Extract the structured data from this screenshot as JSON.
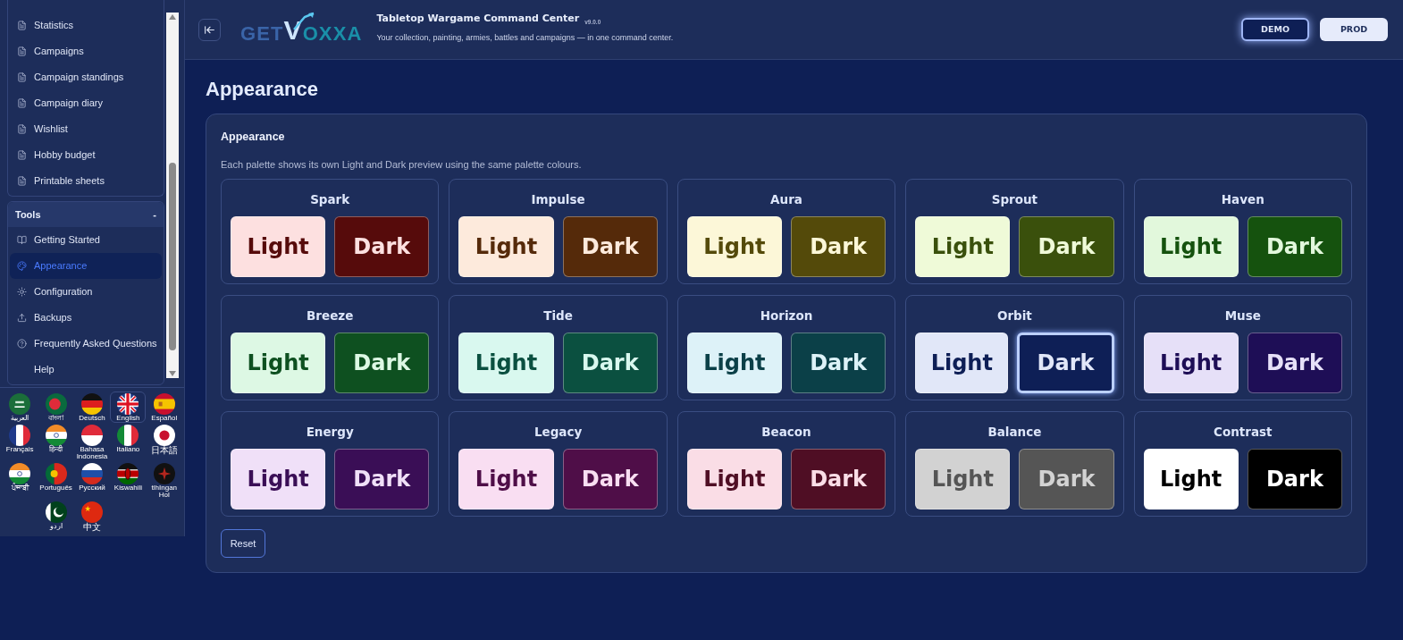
{
  "sidebar": {
    "groups": [
      {
        "items": [
          {
            "label": "Statistics",
            "selected": false
          },
          {
            "label": "Campaigns",
            "selected": false
          },
          {
            "label": "Campaign standings",
            "selected": false
          },
          {
            "label": "Campaign diary",
            "selected": false
          },
          {
            "label": "Wishlist",
            "selected": false
          },
          {
            "label": "Hobby budget",
            "selected": false
          },
          {
            "label": "Printable sheets",
            "selected": false
          }
        ]
      },
      {
        "title": "Tools",
        "toggle": "-",
        "expanded": true,
        "items": [
          {
            "label": "Getting Started",
            "selected": false
          },
          {
            "label": "Appearance",
            "selected": true
          },
          {
            "label": "Configuration",
            "selected": false
          },
          {
            "label": "Backups",
            "selected": false
          },
          {
            "label": "Frequently Asked Questions",
            "selected": false
          },
          {
            "label": "Help",
            "selected": false
          }
        ]
      }
    ],
    "languages": [
      {
        "label": "العربية",
        "selected": false
      },
      {
        "label": "বাংলা",
        "selected": false
      },
      {
        "label": "Deutsch",
        "selected": false
      },
      {
        "label": "English",
        "selected": true
      },
      {
        "label": "Español",
        "selected": false
      },
      {
        "label": "Français",
        "selected": false
      },
      {
        "label": "हिन्दी",
        "selected": false
      },
      {
        "label": "Bahasa Indonesia",
        "selected": false
      },
      {
        "label": "Italiano",
        "selected": false
      },
      {
        "label": "日本語",
        "selected": false
      },
      {
        "label": "ਪੰਜਾਬੀ",
        "selected": false
      },
      {
        "label": "Português",
        "selected": false
      },
      {
        "label": "Русский",
        "selected": false
      },
      {
        "label": "Kiswahili",
        "selected": false
      },
      {
        "label": "tlhIngan Hol",
        "selected": false
      },
      {
        "label": "اردو",
        "selected": false
      },
      {
        "label": "中文",
        "selected": false
      }
    ]
  },
  "header": {
    "logo": {
      "prefix": "GET",
      "mark": "V",
      "suffix": "OXXA"
    },
    "title": "Tabletop Wargame Command Center",
    "version": "v9.0.0",
    "subtitle": "Your collection, painting, armies, battles and campaigns — in one command center.",
    "modes": [
      {
        "label": "DEMO",
        "selected": true
      },
      {
        "label": "PROD",
        "selected": false
      }
    ]
  },
  "page": {
    "title": "Appearance",
    "card": {
      "title": "Appearance",
      "description": "Each palette shows its own Light and Dark preview using the same palette colours.",
      "palettes": [
        {
          "name": "Spark",
          "light": {
            "label": "Light",
            "color": "#fde0e0",
            "selected": false
          },
          "dark": {
            "label": "Dark",
            "color": "#560b0b",
            "selected": false
          }
        },
        {
          "name": "Impulse",
          "light": {
            "label": "Light",
            "color": "#fdeadc",
            "selected": false
          },
          "dark": {
            "label": "Dark",
            "color": "#552a0a",
            "selected": false
          }
        },
        {
          "name": "Aura",
          "light": {
            "label": "Light",
            "color": "#fcf7d8",
            "selected": false
          },
          "dark": {
            "label": "Dark",
            "color": "#544a0a",
            "selected": false
          }
        },
        {
          "name": "Sprout",
          "light": {
            "label": "Light",
            "color": "#effad8",
            "selected": false
          },
          "dark": {
            "label": "Dark",
            "color": "#3a500c",
            "selected": false
          }
        },
        {
          "name": "Haven",
          "light": {
            "label": "Light",
            "color": "#e2f8dc",
            "selected": false
          },
          "dark": {
            "label": "Dark",
            "color": "#15520e",
            "selected": false
          }
        },
        {
          "name": "Breeze",
          "light": {
            "label": "Light",
            "color": "#ddf8e4",
            "selected": false
          },
          "dark": {
            "label": "Dark",
            "color": "#0e5020",
            "selected": false
          }
        },
        {
          "name": "Tide",
          "light": {
            "label": "Light",
            "color": "#d9f8ef",
            "selected": false
          },
          "dark": {
            "label": "Dark",
            "color": "#0b5040",
            "selected": false
          }
        },
        {
          "name": "Horizon",
          "light": {
            "label": "Light",
            "color": "#ddf2f8",
            "selected": false
          },
          "dark": {
            "label": "Dark",
            "color": "#0b4048",
            "selected": false
          }
        },
        {
          "name": "Orbit",
          "light": {
            "label": "Light",
            "color": "#e1e7f8",
            "selected": false
          },
          "dark": {
            "label": "Dark",
            "color": "#0e1f56",
            "selected": true
          }
        },
        {
          "name": "Muse",
          "light": {
            "label": "Light",
            "color": "#e6e0f8",
            "selected": false
          },
          "dark": {
            "label": "Dark",
            "color": "#1e0e56",
            "selected": false
          }
        },
        {
          "name": "Energy",
          "light": {
            "label": "Light",
            "color": "#f0e0f8",
            "selected": false
          },
          "dark": {
            "label": "Dark",
            "color": "#3a0e56",
            "selected": false
          }
        },
        {
          "name": "Legacy",
          "light": {
            "label": "Light",
            "color": "#f9def2",
            "selected": false
          },
          "dark": {
            "label": "Dark",
            "color": "#4f0e48",
            "selected": false
          }
        },
        {
          "name": "Beacon",
          "light": {
            "label": "Light",
            "color": "#fadde6",
            "selected": false
          },
          "dark": {
            "label": "Dark",
            "color": "#4f0e24",
            "selected": false
          }
        },
        {
          "name": "Balance",
          "light": {
            "label": "Light",
            "color": "#d2d2d2",
            "selected": false
          },
          "dark": {
            "label": "Dark",
            "color": "#555555",
            "selected": false
          }
        },
        {
          "name": "Contrast",
          "light": {
            "label": "Light",
            "color": "#ffffff",
            "selected": false
          },
          "dark": {
            "label": "Dark",
            "color": "#000000",
            "selected": false
          }
        }
      ]
    },
    "reset_button": "Reset"
  }
}
